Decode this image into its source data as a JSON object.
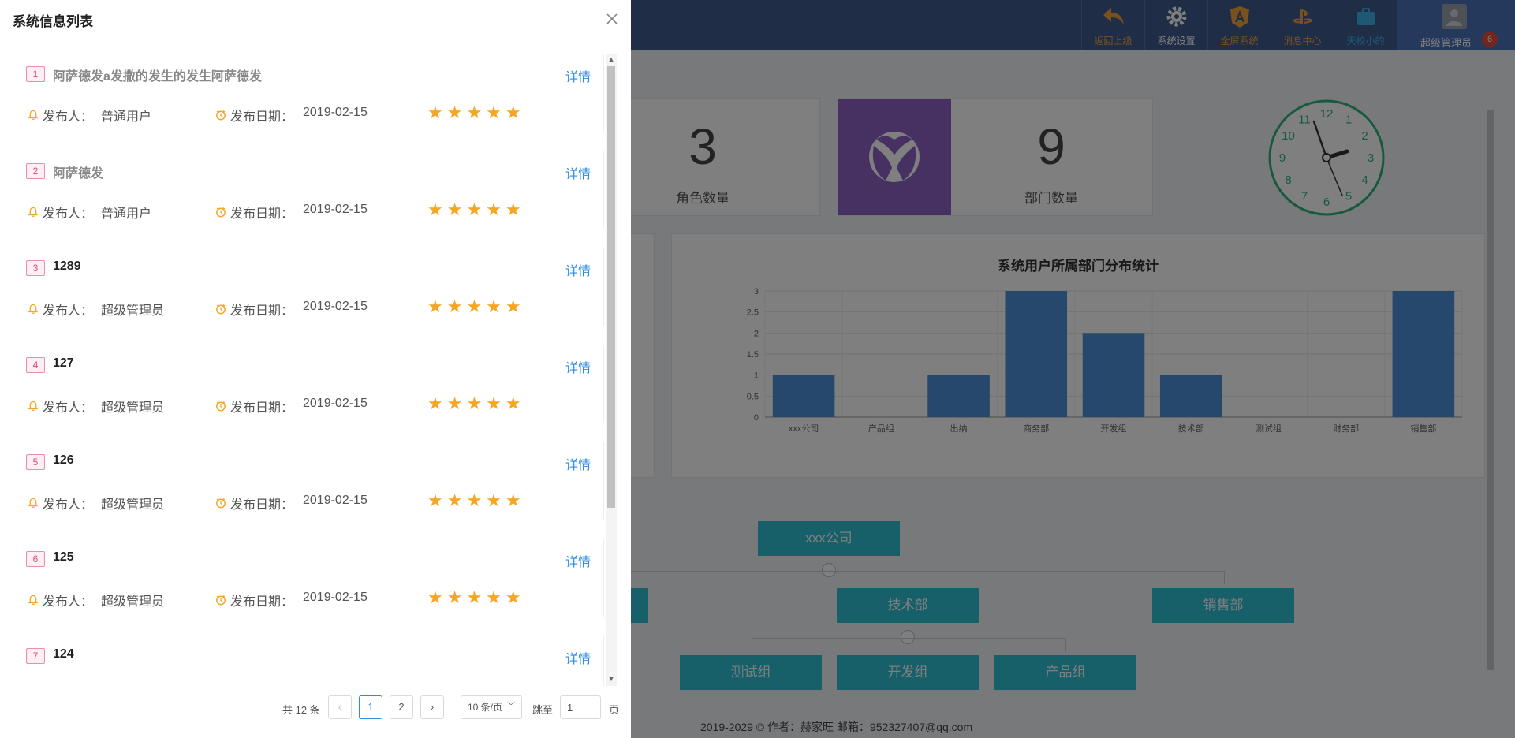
{
  "drawer": {
    "title": "系统信息列表",
    "detail_label": "详情",
    "publisher_label": "发布人：",
    "date_label": "发布日期：",
    "items": [
      {
        "index": "1",
        "title": "阿萨德发a发撒的发生的发生阿萨德发",
        "publisher": "普通用户",
        "date": "2019-02-15",
        "stars": "★★★★★",
        "muted": true
      },
      {
        "index": "2",
        "title": "阿萨德发",
        "publisher": "普通用户",
        "date": "2019-02-15",
        "stars": "★★★★★",
        "muted": true
      },
      {
        "index": "3",
        "title": "1289",
        "publisher": "超级管理员",
        "date": "2019-02-15",
        "stars": "★★★★★",
        "muted": false
      },
      {
        "index": "4",
        "title": "127",
        "publisher": "超级管理员",
        "date": "2019-02-15",
        "stars": "★★★★★",
        "muted": false
      },
      {
        "index": "5",
        "title": "126",
        "publisher": "超级管理员",
        "date": "2019-02-15",
        "stars": "★★★★★",
        "muted": false
      },
      {
        "index": "6",
        "title": "125",
        "publisher": "超级管理员",
        "date": "2019-02-15",
        "stars": "★★★★★",
        "muted": false
      },
      {
        "index": "7",
        "title": "124",
        "publisher": "",
        "date": "",
        "stars": "",
        "muted": false
      }
    ],
    "pagination": {
      "total": "共 12 条",
      "prev": "‹",
      "next": "›",
      "pages": [
        "1",
        "2"
      ],
      "current_page": "1",
      "page_size": "10 条/页",
      "jump_label": "跳至",
      "jump_value": "1",
      "page_unit": "页"
    }
  },
  "topbar": {
    "buttons": [
      {
        "label": "返回上级",
        "icon": "back-arrow-icon",
        "color": "#f0a23b"
      },
      {
        "label": "系统设置",
        "icon": "gear-icon",
        "color": "#ffffff"
      },
      {
        "label": "全屏系统",
        "icon": "angular-shield-icon",
        "color": "#f0a23b"
      },
      {
        "label": "消息中心",
        "icon": "playstation-icon",
        "color": "#f0a23b"
      },
      {
        "label": "天校小的",
        "icon": "briefcase-icon",
        "color": "#3fb1e8"
      }
    ],
    "user": {
      "name": "超级管理员",
      "badge": "6"
    }
  },
  "dashboard": {
    "stats": [
      {
        "value": "3",
        "label": "角色数量"
      },
      {
        "value": "9",
        "label": "部门数量"
      }
    ],
    "clock_numbers": [
      "12",
      "1",
      "2",
      "3",
      "4",
      "5",
      "6",
      "7",
      "8",
      "9",
      "10",
      "11"
    ],
    "org": {
      "root": "xxx公司",
      "level2": [
        "技术部",
        "销售部"
      ],
      "level3": [
        "测试组",
        "开发组",
        "产品组"
      ]
    },
    "footer": "2019-2029 © 作者：赫家旺 邮箱：952327407@qq.com"
  },
  "chart_data": {
    "type": "bar",
    "title": "系统用户所属部门分布统计",
    "categories": [
      "xxx公司",
      "产品组",
      "出纳",
      "商务部",
      "开发组",
      "技术部",
      "测试组",
      "财务部",
      "销售部"
    ],
    "values": [
      1,
      0,
      1,
      3,
      2,
      1,
      0,
      0,
      3
    ],
    "yticks": [
      "0",
      "0.5",
      "1",
      "1.5",
      "2",
      "2.5",
      "3"
    ],
    "ylim": [
      0,
      3
    ],
    "grid": true,
    "color": "#4a90d9"
  }
}
